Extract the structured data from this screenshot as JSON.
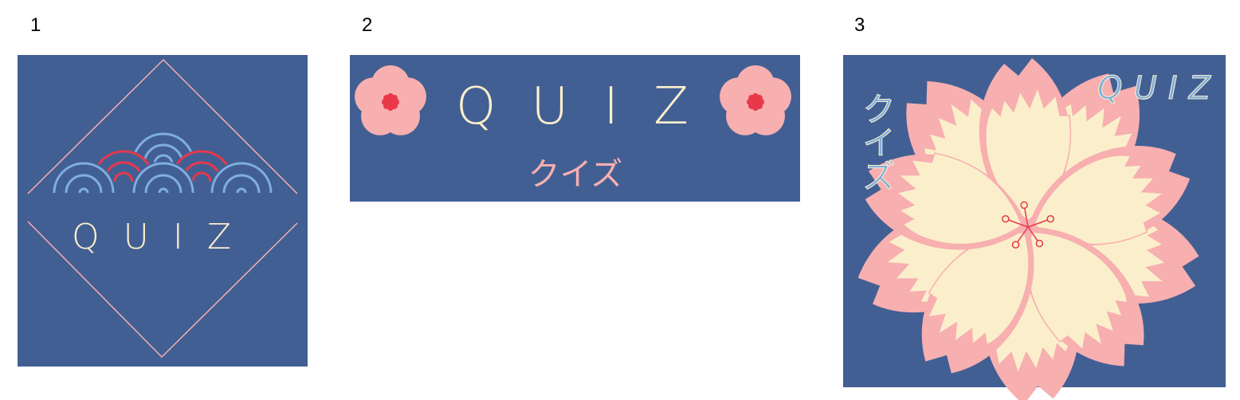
{
  "panels": [
    {
      "number": "1",
      "title": "QUIZ"
    },
    {
      "number": "2",
      "title": "QUIZ",
      "subtitle": "クイズ"
    },
    {
      "number": "3",
      "title": "QUIZ",
      "subtitle": "クイズ"
    }
  ],
  "colors": {
    "background": "#425F94",
    "cream": "#FBEFCB",
    "pink": "#F7AFB0",
    "red": "#E8384A",
    "light_blue": "#7FAEDF"
  },
  "icons": [
    "seigaiha-wave-icon",
    "plum-blossom-icon",
    "cherry-blossom-icon"
  ]
}
